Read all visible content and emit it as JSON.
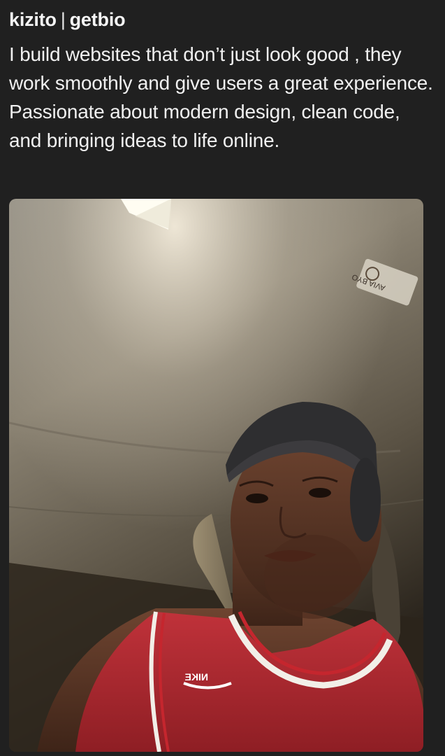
{
  "post": {
    "author_name": "kizito",
    "separator": "|",
    "author_handle": "getbio",
    "bio": "I build websites that don’t just look good , they work smoothly and give users a great experience. Passionate about modern design, clean code, and bringing ideas to life online."
  },
  "photo": {
    "subject": "selfie-in-car",
    "sticker_text": "AVIA BYO",
    "jersey_logo_text": "NIKE"
  },
  "colors": {
    "background": "#202020",
    "text": "#f2f2f2",
    "jersey": "#b3262b"
  }
}
